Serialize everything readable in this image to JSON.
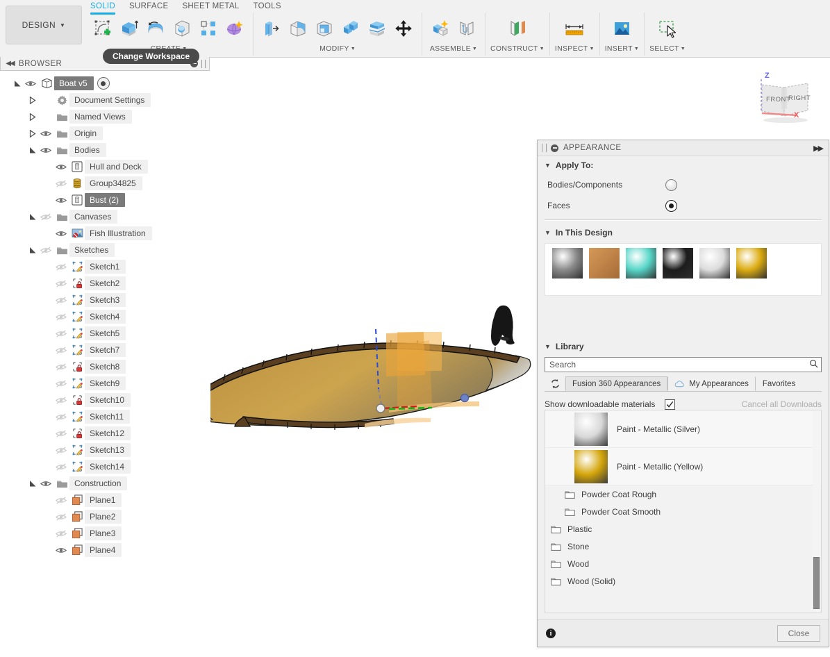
{
  "app": {
    "design_button": "DESIGN",
    "tooltip": "Change Workspace"
  },
  "workspace_tabs": [
    {
      "label": "SOLID",
      "active": true
    },
    {
      "label": "SURFACE",
      "active": false
    },
    {
      "label": "SHEET METAL",
      "active": false
    },
    {
      "label": "TOOLS",
      "active": false
    }
  ],
  "ribbon_groups": [
    {
      "label": "CREATE",
      "dropdown": true,
      "icons": [
        "create-sketch-icon",
        "extrude-icon",
        "revolve-icon",
        "sweep-icon",
        "pattern-icon",
        "form-icon"
      ]
    },
    {
      "label": "MODIFY",
      "dropdown": true,
      "icons": [
        "press-pull-icon",
        "fillet-icon",
        "shell-icon",
        "combine-icon",
        "split-face-icon",
        "move-copy-icon"
      ]
    },
    {
      "label": "ASSEMBLE",
      "dropdown": true,
      "icons": [
        "new-component-icon",
        "joint-icon"
      ]
    },
    {
      "label": "CONSTRUCT",
      "dropdown": true,
      "icons": [
        "offset-plane-icon"
      ]
    },
    {
      "label": "INSPECT",
      "dropdown": true,
      "icons": [
        "measure-icon"
      ]
    },
    {
      "label": "INSERT",
      "dropdown": true,
      "icons": [
        "insert-image-icon"
      ]
    },
    {
      "label": "SELECT",
      "dropdown": true,
      "icons": [
        "window-select-icon"
      ]
    }
  ],
  "browser": {
    "title": "BROWSER",
    "collapse_icon": "collapse-left-icon",
    "tree": [
      {
        "label": "Boat v5",
        "depth": 0,
        "arrow": "expanded",
        "eye": "visible",
        "icon": "component-icon",
        "selected": true,
        "radio": true
      },
      {
        "label": "Document Settings",
        "depth": 1,
        "arrow": "collapsed",
        "eye": "none",
        "icon": "gear-icon",
        "selected": false,
        "radio": false
      },
      {
        "label": "Named Views",
        "depth": 1,
        "arrow": "collapsed",
        "eye": "none",
        "icon": "folder-icon",
        "selected": false,
        "radio": false
      },
      {
        "label": "Origin",
        "depth": 1,
        "arrow": "collapsed",
        "eye": "visible",
        "icon": "folder-icon",
        "selected": false,
        "radio": false
      },
      {
        "label": "Bodies",
        "depth": 1,
        "arrow": "expanded",
        "eye": "visible",
        "icon": "folder-icon",
        "selected": false,
        "radio": false
      },
      {
        "label": "Hull and Deck",
        "depth": 2,
        "arrow": "none",
        "eye": "visible",
        "icon": "body-icon",
        "selected": false,
        "radio": false
      },
      {
        "label": "Group34825",
        "depth": 2,
        "arrow": "none",
        "eye": "hidden",
        "icon": "group-body-icon",
        "selected": false,
        "radio": false
      },
      {
        "label": "Bust (2)",
        "depth": 2,
        "arrow": "none",
        "eye": "visible",
        "icon": "body-icon",
        "selected": true,
        "radio": false
      },
      {
        "label": "Canvases",
        "depth": 1,
        "arrow": "expanded",
        "eye": "hidden",
        "icon": "folder-icon",
        "selected": false,
        "radio": false
      },
      {
        "label": "Fish Illustration",
        "depth": 2,
        "arrow": "none",
        "eye": "visible",
        "icon": "canvas-icon",
        "selected": false,
        "radio": false
      },
      {
        "label": "Sketches",
        "depth": 1,
        "arrow": "expanded",
        "eye": "hidden",
        "icon": "folder-icon",
        "selected": false,
        "radio": false
      },
      {
        "label": "Sketch1",
        "depth": 2,
        "arrow": "none",
        "eye": "hidden",
        "icon": "sketch-icon",
        "selected": false,
        "radio": false
      },
      {
        "label": "Sketch2",
        "depth": 2,
        "arrow": "none",
        "eye": "hidden",
        "icon": "sketch-locked-icon",
        "selected": false,
        "radio": false
      },
      {
        "label": "Sketch3",
        "depth": 2,
        "arrow": "none",
        "eye": "hidden",
        "icon": "sketch-icon",
        "selected": false,
        "radio": false
      },
      {
        "label": "Sketch4",
        "depth": 2,
        "arrow": "none",
        "eye": "hidden",
        "icon": "sketch-icon",
        "selected": false,
        "radio": false
      },
      {
        "label": "Sketch5",
        "depth": 2,
        "arrow": "none",
        "eye": "hidden",
        "icon": "sketch-icon",
        "selected": false,
        "radio": false
      },
      {
        "label": "Sketch7",
        "depth": 2,
        "arrow": "none",
        "eye": "hidden",
        "icon": "sketch-icon",
        "selected": false,
        "radio": false
      },
      {
        "label": "Sketch8",
        "depth": 2,
        "arrow": "none",
        "eye": "hidden",
        "icon": "sketch-locked-icon",
        "selected": false,
        "radio": false
      },
      {
        "label": "Sketch9",
        "depth": 2,
        "arrow": "none",
        "eye": "hidden",
        "icon": "sketch-icon",
        "selected": false,
        "radio": false
      },
      {
        "label": "Sketch10",
        "depth": 2,
        "arrow": "none",
        "eye": "hidden",
        "icon": "sketch-locked-icon",
        "selected": false,
        "radio": false
      },
      {
        "label": "Sketch11",
        "depth": 2,
        "arrow": "none",
        "eye": "hidden",
        "icon": "sketch-icon",
        "selected": false,
        "radio": false
      },
      {
        "label": "Sketch12",
        "depth": 2,
        "arrow": "none",
        "eye": "hidden",
        "icon": "sketch-locked-icon",
        "selected": false,
        "radio": false
      },
      {
        "label": "Sketch13",
        "depth": 2,
        "arrow": "none",
        "eye": "hidden",
        "icon": "sketch-icon",
        "selected": false,
        "radio": false
      },
      {
        "label": "Sketch14",
        "depth": 2,
        "arrow": "none",
        "eye": "hidden",
        "icon": "sketch-icon",
        "selected": false,
        "radio": false
      },
      {
        "label": "Construction",
        "depth": 1,
        "arrow": "expanded",
        "eye": "visible",
        "icon": "folder-icon",
        "selected": false,
        "radio": false
      },
      {
        "label": "Plane1",
        "depth": 2,
        "arrow": "none",
        "eye": "hidden",
        "icon": "plane-icon",
        "selected": false,
        "radio": false
      },
      {
        "label": "Plane2",
        "depth": 2,
        "arrow": "none",
        "eye": "hidden",
        "icon": "plane-icon",
        "selected": false,
        "radio": false
      },
      {
        "label": "Plane3",
        "depth": 2,
        "arrow": "none",
        "eye": "hidden",
        "icon": "plane-icon",
        "selected": false,
        "radio": false
      },
      {
        "label": "Plane4",
        "depth": 2,
        "arrow": "none",
        "eye": "visible",
        "icon": "plane-icon",
        "selected": false,
        "radio": false
      }
    ]
  },
  "viewcube": {
    "front_label": "FRONT",
    "right_label": "RIGHT",
    "axis_z": "Z",
    "axis_x": "X"
  },
  "appearance": {
    "title": "APPEARANCE",
    "apply_to": {
      "header": "Apply To:",
      "options": [
        {
          "label": "Bodies/Components",
          "selected": false
        },
        {
          "label": "Faces",
          "selected": true
        }
      ]
    },
    "in_this_design": {
      "header": "In This Design",
      "swatches": [
        {
          "name": "chrome-swatch",
          "color": "#8a8a8a"
        },
        {
          "name": "wood-swatch",
          "color": "#c08a4a"
        },
        {
          "name": "paint-teal-swatch",
          "color": "#58d6c8"
        },
        {
          "name": "paint-black-swatch",
          "color": "#1c1c1c"
        },
        {
          "name": "paint-silver-swatch",
          "color": "#dcdcdc"
        },
        {
          "name": "paint-yellow-swatch",
          "color": "#dcac12"
        }
      ]
    },
    "library": {
      "header": "Library",
      "search_placeholder": "Search",
      "search_value": "",
      "search_icon": "magnifier-icon",
      "refresh_icon": "refresh-icon",
      "tabs": [
        {
          "label": "Fusion 360 Appearances",
          "active": true,
          "icon": null
        },
        {
          "label": "My Appearances",
          "active": false,
          "icon": "cloud-icon"
        },
        {
          "label": "Favorites",
          "active": false,
          "icon": null
        }
      ],
      "show_downloadable_label": "Show downloadable materials",
      "show_downloadable_checked": true,
      "cancel_downloads_label": "Cancel all Downloads",
      "materials": [
        {
          "name": "Paint - Metallic (Silver)",
          "color": "#d8d8d8"
        },
        {
          "name": "Paint - Metallic (Yellow)",
          "color": "#d4a50a"
        }
      ],
      "folders": [
        {
          "name": "Powder Coat Rough",
          "indent": true
        },
        {
          "name": "Powder Coat Smooth",
          "indent": true
        },
        {
          "name": "Plastic",
          "indent": false
        },
        {
          "name": "Stone",
          "indent": false
        },
        {
          "name": "Wood",
          "indent": false
        },
        {
          "name": "Wood (Solid)",
          "indent": false
        }
      ]
    },
    "footer": {
      "info_icon": "info-icon",
      "info_glyph": "i",
      "close_label": "Close"
    }
  }
}
